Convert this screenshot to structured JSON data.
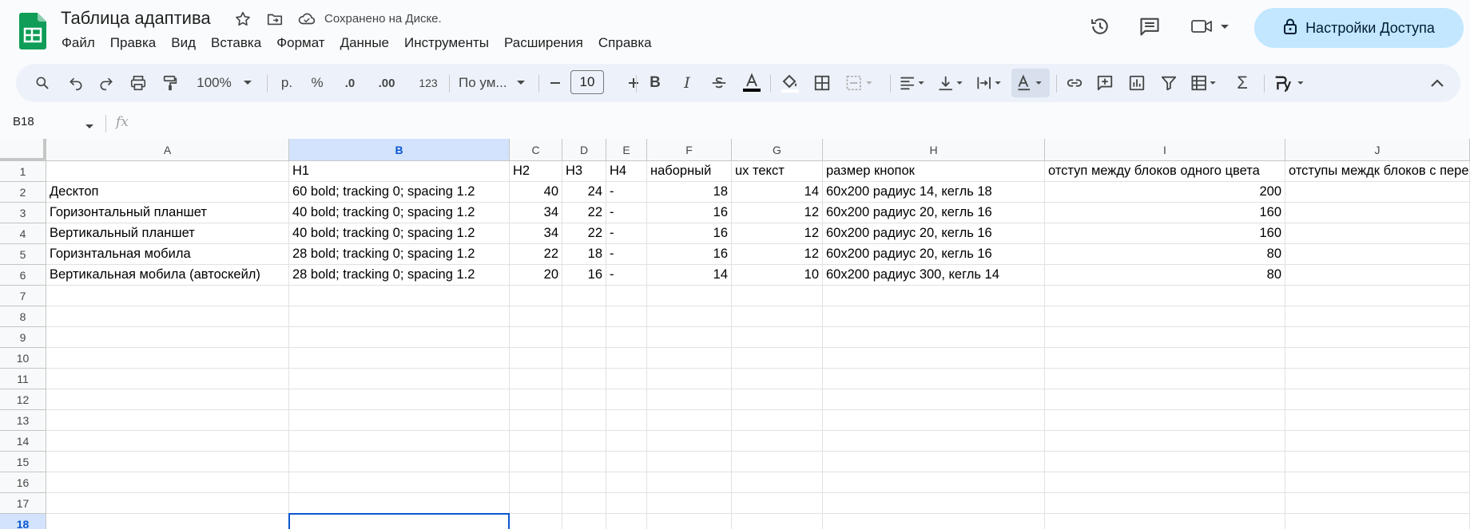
{
  "header": {
    "doc_title": "Таблица адаптива",
    "saved_status": "Сохранено на Диске.",
    "menu": [
      "Файл",
      "Правка",
      "Вид",
      "Вставка",
      "Формат",
      "Данные",
      "Инструменты",
      "Расширения",
      "Справка"
    ],
    "share_label": "Настройки Доступа"
  },
  "toolbar": {
    "zoom": "100%",
    "currency": "р.",
    "percent": "%",
    "decrease_decimal": ".0",
    "increase_decimal": ".00",
    "number_format": "123",
    "font": "По ум...",
    "font_size": "10"
  },
  "formula_bar": {
    "name_box": "B18",
    "fx": "fx",
    "value": ""
  },
  "grid": {
    "columns": [
      "A",
      "B",
      "C",
      "D",
      "E",
      "F",
      "G",
      "H",
      "I",
      "J"
    ],
    "selected_column": "B",
    "row_numbers": [
      "1",
      "2",
      "3",
      "4",
      "5",
      "6",
      "7",
      "8",
      "9",
      "10",
      "11",
      "12",
      "13",
      "14",
      "15",
      "16",
      "17",
      "18"
    ],
    "selected_row": "18",
    "rows": [
      [
        "",
        "H1",
        "H2",
        "H3",
        "H4",
        "наборный",
        "ux текст",
        "размер кнопок",
        "отступ между блоков одного цвета",
        "отступы междк блоков с перепадом цвета"
      ],
      [
        "Десктоп",
        "60 bold; tracking 0; spacing 1.2",
        "40",
        "24",
        "-",
        "18",
        "14",
        "60x200 радиус 14, кегль 18",
        "200",
        ""
      ],
      [
        "Горизонтальный планшет",
        "40 bold; tracking 0; spacing 1.2",
        "34",
        "22",
        "-",
        "16",
        "12",
        "60x200 радиус 20, кегль 16",
        "160",
        ""
      ],
      [
        "Вертикальный планшет",
        "40 bold; tracking 0; spacing 1.2",
        "34",
        "22",
        "-",
        "16",
        "12",
        "60x200 радиус 20, кегль 16",
        "160",
        ""
      ],
      [
        "Горизнтальная мобила",
        "28 bold; tracking 0; spacing 1.2",
        "22",
        "18",
        "-",
        "16",
        "12",
        "60x200 радиус 20, кегль 16",
        "80",
        ""
      ],
      [
        "Вертикальная мобила (автоскейл)",
        "28 bold; tracking 0; spacing 1.2",
        "20",
        "16",
        "-",
        "14",
        "10",
        "60x200 радиус 300, кегль 14",
        "80",
        ""
      ]
    ]
  },
  "colors": {
    "accent": "#0b57d0",
    "share_bg": "#c2e7ff",
    "toolbar_bg": "#edf2fa",
    "sheets_green": "#0f9d58"
  }
}
